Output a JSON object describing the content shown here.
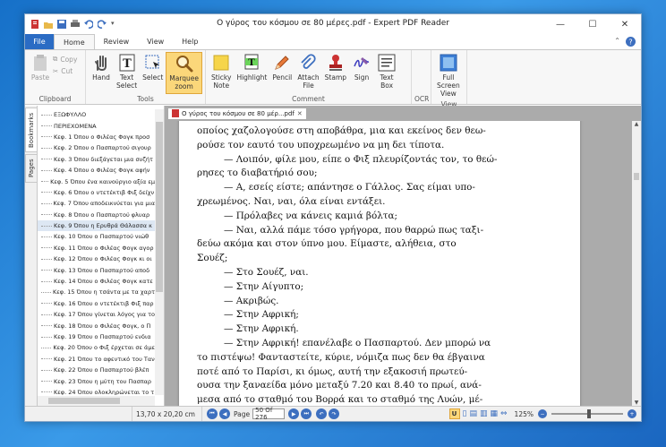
{
  "window": {
    "title": "Ο γύρος του κόσμου σε 80 μέρες.pdf - Expert PDF Reader"
  },
  "tabs": {
    "file": "File",
    "home": "Home",
    "review": "Review",
    "view": "View",
    "help": "Help"
  },
  "ribbon": {
    "clipboard": {
      "label": "Clipboard",
      "paste": "Paste",
      "copy": "Copy",
      "cut": "Cut"
    },
    "tools": {
      "label": "Tools",
      "hand": "Hand",
      "text_select_1": "Text",
      "text_select_2": "Select",
      "select": "Select",
      "marquee_zoom_1": "Marquee",
      "marquee_zoom_2": "zoom"
    },
    "comment": {
      "label": "Comment",
      "sticky_note_1": "Sticky",
      "sticky_note_2": "Note",
      "highlight": "Highlight",
      "pencil": "Pencil",
      "attach_file_1": "Attach",
      "attach_file_2": "File",
      "stamp": "Stamp",
      "sign": "Sign",
      "text_box_1": "Text",
      "text_box_2": "Box"
    },
    "ocr": {
      "label": "OCR"
    },
    "view": {
      "label": "View",
      "full_screen_1": "Full",
      "full_screen_2": "Screen",
      "full_screen_3": "View"
    }
  },
  "side_tabs": {
    "bookmarks": "Bookmarks",
    "pages": "Pages"
  },
  "bookmarks": [
    "ΕΞΩΦΥΛΛΟ",
    "ΠΕΡΙΕΧΟΜΕΝΑ",
    "Κεφ. 1 Όπου ο Φιλέας Φογκ προσ",
    "Κεφ. 2 Όπου ο Πασπαρτού σιγουρ",
    "Κεφ. 3 Όπου διεξάγεται μια συζήτ",
    "Κεφ. 4 Όπου ο Φιλέας Φογκ αφήν",
    "Κεφ. 5 Όπου ένα καινούργιο αξία εμ",
    "Κεφ. 6 Όπου ο ντετέκτιβ Φιξ δείχν",
    "Κεφ. 7 Όπου αποδεικνύεται για μια",
    "Κεφ. 8 Όπου ο Πασπαρτού φλυαρ",
    "Κεφ. 9 Όπου η Ερυθρά Θάλασσα κ",
    "Κεφ. 10 Όπου ο Πασπαρτού νιώθ",
    "Κεφ. 11 Όπου ο Φιλέας Φογκ αγορ",
    "Κεφ. 12 Όπου ο Φιλέας Φογκ κι οι",
    "Κεφ. 13 Όπου ο Πασπαρτού αποδ",
    "Κεφ. 14 Όπου ο Φιλέας Φογκ κατε",
    "Κεφ. 15 Όπου η τσάντα με τα χαρτ",
    "Κεφ. 16 Όπου ο ντετέκτιβ Φιξ παρ",
    "Κεφ. 17 Όπου γίνεται λόγος για το",
    "Κεφ. 18 Όπου ο Φιλέας Φογκ, ο Π",
    "Κεφ. 19 Όπου ο Πασπαρτού ενδια",
    "Κεφ. 20 Όπου ο Φιξ έρχεται σε άμε",
    "Κεφ. 21 Όπου το αφεντικό του Ταν",
    "Κεφ. 22 Όπου ο Πασπαρτού βλέπ",
    "Κεφ. 23 Όπου η μύτη του Πασπαρ",
    "Κεφ. 24 Όπου ολοκληρώνεται το τ",
    "Κεφ. 25 Όπου παίρνουμε μια ιδέα"
  ],
  "document": {
    "tab_label": "Ο γύρος του κόσμου σε 80 μέρ...pdf",
    "lines": [
      "οποίος χαζολογούσε στη αποβάθρα, μια και εκείνος δεν θεω-",
      "ρούσε τον εαυτό του υποχρεωμένο να μη δει τίποτα.",
      "— Λοιπόν, φίλε μου, είπε ο Φιξ πλευρίζοντάς τον, το θεώ-",
      "ρησες το διαβατήριό σου;",
      "— Α, εσείς είστε; απάντησε ο Γάλλος. Σας είμαι υπο-",
      "χρεωμένος. Ναι, ναι, όλα είναι εντάξει.",
      "— Πρόλαβες να κάνεις καμιά βόλτα;",
      "— Ναι, αλλά πάμε τόσο γρήγορα, που θαρρώ πως ταξι-",
      "δεύω ακόμα και στον ύπνο μου. Είμαστε, αλήθεια, στο",
      "Σουέζ;",
      "— Στο Σουέζ, ναι.",
      "— Στην Αίγυπτο;",
      "— Ακριβώς.",
      "— Στην Αφρική;",
      "— Στην Αφρική.",
      "— Στην Αφρική! επανέλαβε ο Πασπαρτού. Δεν μπορώ να",
      "το πιστέψω! Φανταστείτε, κύριε, νόμιζα πως δεν θα έβγαινα",
      "ποτέ από το Παρίσι, κι όμως, αυτή την εξακοσιή πρωτεύ-",
      "ουσα την ξαναείδα μόνο μεταξύ 7.20 και 8.40 το πρωί, ανά-",
      "μεσα από το σταθμό του Βορρά και το σταθμό της Λυών, μέ-",
      "σα από τα τζάμια μιας άμαξας και με καταρρακτώδη βροχή!"
    ]
  },
  "status": {
    "page_size": "13,70 x 20,20 cm",
    "page_label": "Page",
    "page_value": "50 Of 276",
    "zoom": "125%"
  }
}
